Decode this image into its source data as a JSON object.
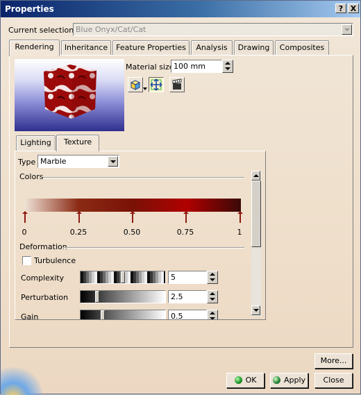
{
  "window": {
    "title": "Properties",
    "help_label": "?",
    "close_label": "X"
  },
  "selection": {
    "label": "Current selection :",
    "value": "Blue Onyx/Cat/Cat"
  },
  "main_tabs": [
    {
      "label": "Rendering",
      "active": true
    },
    {
      "label": "Inheritance",
      "active": false
    },
    {
      "label": "Feature Properties",
      "active": false
    },
    {
      "label": "Analysis",
      "active": false
    },
    {
      "label": "Drawing",
      "active": false
    },
    {
      "label": "Composites",
      "active": false
    }
  ],
  "material": {
    "size_label": "Material size:",
    "size_value": "100 mm",
    "icons": [
      "mapping-box-icon",
      "adjust-arrows-icon",
      "clapper-icon"
    ]
  },
  "sub_tabs": [
    {
      "label": "Lighting",
      "active": false
    },
    {
      "label": "Texture",
      "active": true
    }
  ],
  "texture": {
    "type_label": "Type",
    "type_value": "Marble",
    "colors_label": "Colors",
    "gradient_start": "#efe2d6",
    "gradient_mid": "#8a2a14",
    "gradient_peak": "#b00000",
    "gradient_end": "#3a0a08",
    "ticks": [
      "0",
      "0.25",
      "0.50",
      "0.75",
      "1"
    ],
    "deformation_label": "Deformation",
    "turbulence_label": "Turbulence",
    "turbulence_checked": false,
    "params": [
      {
        "label": "Complexity",
        "value": "5",
        "level": 0.5
      },
      {
        "label": "Perturbation",
        "value": "2.5",
        "level": 0.18
      },
      {
        "label": "Gain",
        "value": "0.5",
        "level": 0.25
      }
    ]
  },
  "buttons": {
    "more": "More...",
    "ok": "OK",
    "apply": "Apply",
    "close": "Close"
  }
}
